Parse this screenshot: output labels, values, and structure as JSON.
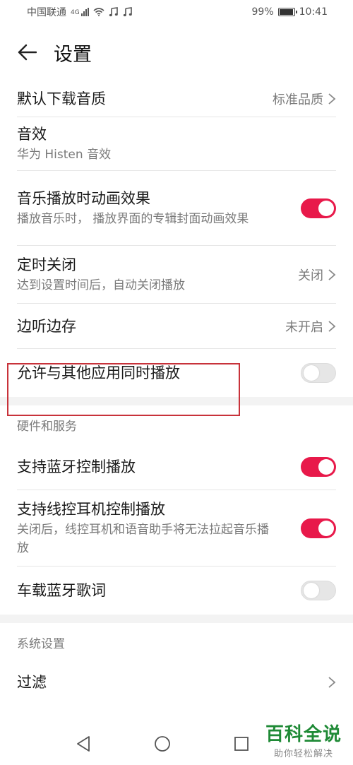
{
  "status_bar": {
    "carrier": "中国联通",
    "network": "4G",
    "battery": "99%",
    "battery_level": 0.99,
    "time": "10:41",
    "icons": [
      "signal-icon",
      "wifi-icon",
      "music-note-icon",
      "music-note-icon",
      "battery-icon"
    ]
  },
  "header": {
    "title": "设置",
    "back_icon": "arrow-left-icon"
  },
  "settings": {
    "download_quality": {
      "title": "默认下载音质",
      "value": "标准品质"
    },
    "sound_effect": {
      "title": "音效",
      "subtitle": "华为 Histen 音效"
    },
    "animation": {
      "title": "音乐播放时动画效果",
      "subtitle": "播放音乐时， 播放界面的专辑封面动画效果",
      "enabled": true
    },
    "timer": {
      "title": "定时关闭",
      "subtitle": "达到设置时间后，自动关闭播放",
      "value": "关闭"
    },
    "cache": {
      "title": "边听边存",
      "value": "未开启"
    },
    "allow_mix": {
      "title": "允许与其他应用同时播放",
      "enabled": false
    }
  },
  "hardware": {
    "section_title": "硬件和服务",
    "bluetooth_control": {
      "title": "支持蓝牙控制播放",
      "enabled": true
    },
    "wired_control": {
      "title": "支持线控耳机控制播放",
      "subtitle": "关闭后，线控耳机和语音助手将无法拉起音乐播放",
      "enabled": true
    },
    "car_lyrics": {
      "title": "车载蓝牙歌词",
      "enabled": false
    }
  },
  "system": {
    "section_title": "系统设置",
    "filter": {
      "title": "过滤"
    }
  },
  "nav": {
    "back": "triangle-back-icon",
    "home": "circle-home-icon",
    "recents": "square-recents-icon"
  },
  "watermark": {
    "main": "百科全说",
    "sub": "助你轻松解决"
  },
  "colors": {
    "accent": "#e8194a",
    "highlight": "#c8323a",
    "watermark": "#1f8a36"
  }
}
